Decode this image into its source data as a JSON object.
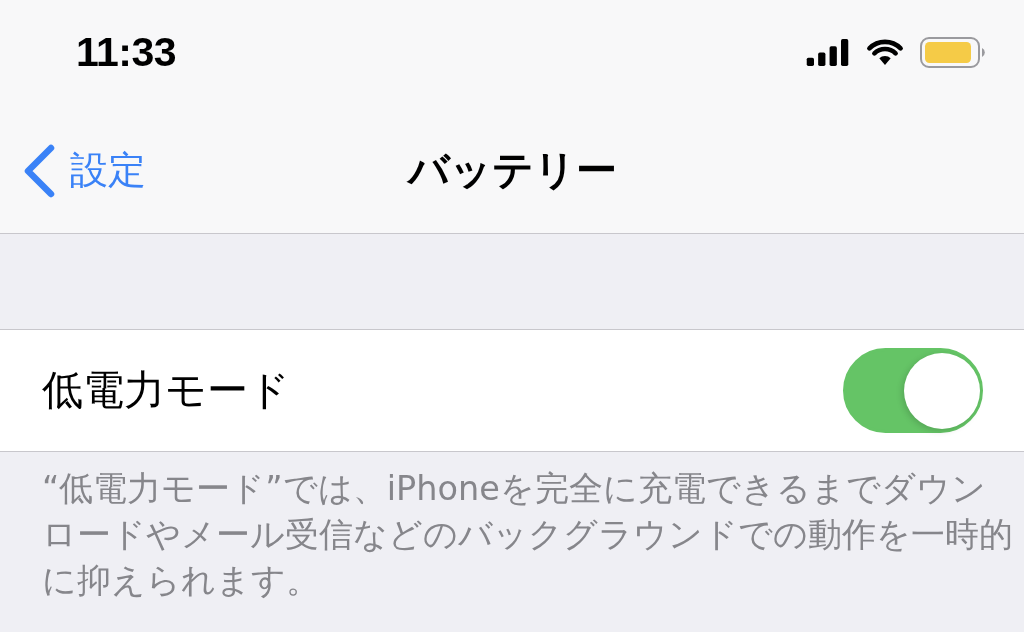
{
  "status_bar": {
    "time": "11:33"
  },
  "nav_bar": {
    "back_label": "設定",
    "title": "バッテリー"
  },
  "section": {
    "rows": [
      {
        "kind": "toggle",
        "label": "低電力モード",
        "on": true
      }
    ],
    "footer": "“低電力モード”では、iPhoneを完全に充電できるまでダウンロードやメール受信などのバックグラウンドでの動作を一時的に抑えられます。"
  }
}
